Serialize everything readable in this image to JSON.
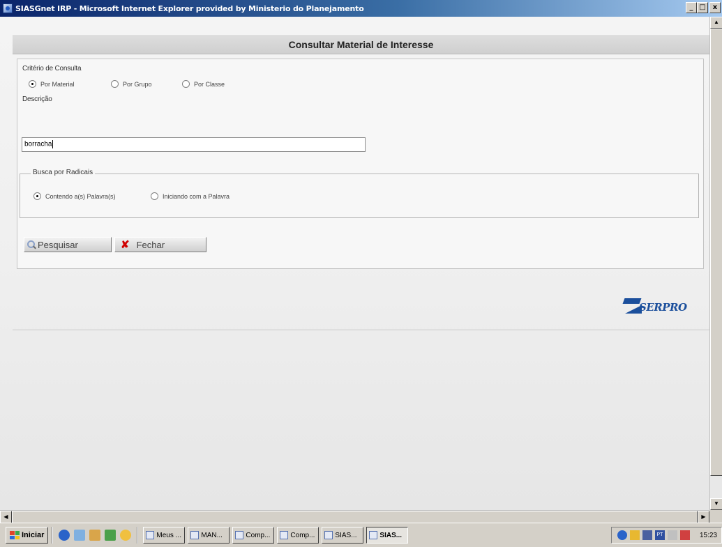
{
  "window": {
    "title": "SIASGnet IRP - Microsoft Internet Explorer provided by Ministerio do Planejamento",
    "minimize": "_",
    "maximize": "□",
    "close": "x"
  },
  "page": {
    "header": "Consultar Material de Interesse",
    "criteria_label": "Critério de Consulta",
    "criteria_options": [
      {
        "label": "Por Material",
        "checked": true
      },
      {
        "label": "Por Grupo",
        "checked": false
      },
      {
        "label": "Por Classe",
        "checked": false
      }
    ],
    "description_label": "Descrição",
    "description_value": "borracha",
    "radical_legend": "Busca por Radicais",
    "radical_options": [
      {
        "label": "Contendo a(s) Palavra(s)",
        "checked": true
      },
      {
        "label": "Iniciando com a Palavra",
        "checked": false
      }
    ],
    "search_button": "Pesquisar",
    "close_button": "Fechar",
    "logo_text": "SERPRO"
  },
  "taskbar": {
    "start_label": "Iniciar",
    "tasks": [
      {
        "label": "Meus ...",
        "active": false
      },
      {
        "label": "MAN...",
        "active": false
      },
      {
        "label": "Comp...",
        "active": false
      },
      {
        "label": "Comp...",
        "active": false
      },
      {
        "label": "SIAS...",
        "active": false
      },
      {
        "label": "SIAS...",
        "active": true
      }
    ],
    "tray_lang": "PT",
    "clock": "15:23"
  },
  "colors": {
    "titlebar_start": "#0a246a",
    "brand_blue": "#1b4f9c",
    "close_icon": "#d00000"
  }
}
